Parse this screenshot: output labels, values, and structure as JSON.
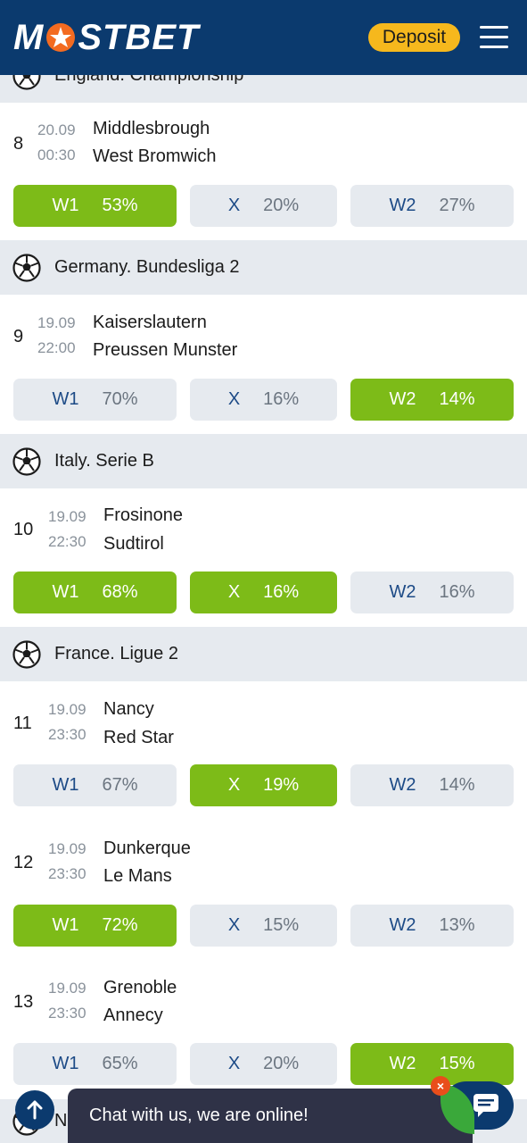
{
  "header": {
    "logo": "MOSTBET",
    "deposit_label": "Deposit"
  },
  "leagues": [
    {
      "name": "England. Championship"
    },
    {
      "name": "Germany. Bundesliga 2"
    },
    {
      "name": "Italy. Serie B"
    },
    {
      "name": "France. Ligue 2"
    },
    {
      "name": "N"
    }
  ],
  "matches": [
    {
      "num": "8",
      "date": "20.09",
      "time": "00:30",
      "home": "Middlesbrough",
      "away": "West Bromwich",
      "odds": [
        {
          "label": "W1",
          "pct": "53%"
        },
        {
          "label": "X",
          "pct": "20%"
        },
        {
          "label": "W2",
          "pct": "27%"
        }
      ]
    },
    {
      "num": "9",
      "date": "19.09",
      "time": "22:00",
      "home": "Kaiserslautern",
      "away": "Preussen Munster",
      "odds": [
        {
          "label": "W1",
          "pct": "70%"
        },
        {
          "label": "X",
          "pct": "16%"
        },
        {
          "label": "W2",
          "pct": "14%"
        }
      ]
    },
    {
      "num": "10",
      "date": "19.09",
      "time": "22:30",
      "home": "Frosinone",
      "away": "Sudtirol",
      "odds": [
        {
          "label": "W1",
          "pct": "68%"
        },
        {
          "label": "X",
          "pct": "16%"
        },
        {
          "label": "W2",
          "pct": "16%"
        }
      ]
    },
    {
      "num": "11",
      "date": "19.09",
      "time": "23:30",
      "home": "Nancy",
      "away": "Red Star",
      "odds": [
        {
          "label": "W1",
          "pct": "67%"
        },
        {
          "label": "X",
          "pct": "19%"
        },
        {
          "label": "W2",
          "pct": "14%"
        }
      ]
    },
    {
      "num": "12",
      "date": "19.09",
      "time": "23:30",
      "home": "Dunkerque",
      "away": "Le Mans",
      "odds": [
        {
          "label": "W1",
          "pct": "72%"
        },
        {
          "label": "X",
          "pct": "15%"
        },
        {
          "label": "W2",
          "pct": "13%"
        }
      ]
    },
    {
      "num": "13",
      "date": "19.09",
      "time": "23:30",
      "home": "Grenoble",
      "away": "Annecy",
      "odds": [
        {
          "label": "W1",
          "pct": "65%"
        },
        {
          "label": "X",
          "pct": "20%"
        },
        {
          "label": "W2",
          "pct": "15%"
        }
      ]
    }
  ],
  "chat": {
    "text": "Chat with us, we are online!",
    "close": "×"
  },
  "colors": {
    "header_bg": "#0b3a6e",
    "deposit_bg": "#f6b81d",
    "highlight_green": "#7dbb18",
    "odd_bg": "#e6eaef",
    "league_bg": "#e6eaef",
    "odd_label": "#1c4a86"
  }
}
